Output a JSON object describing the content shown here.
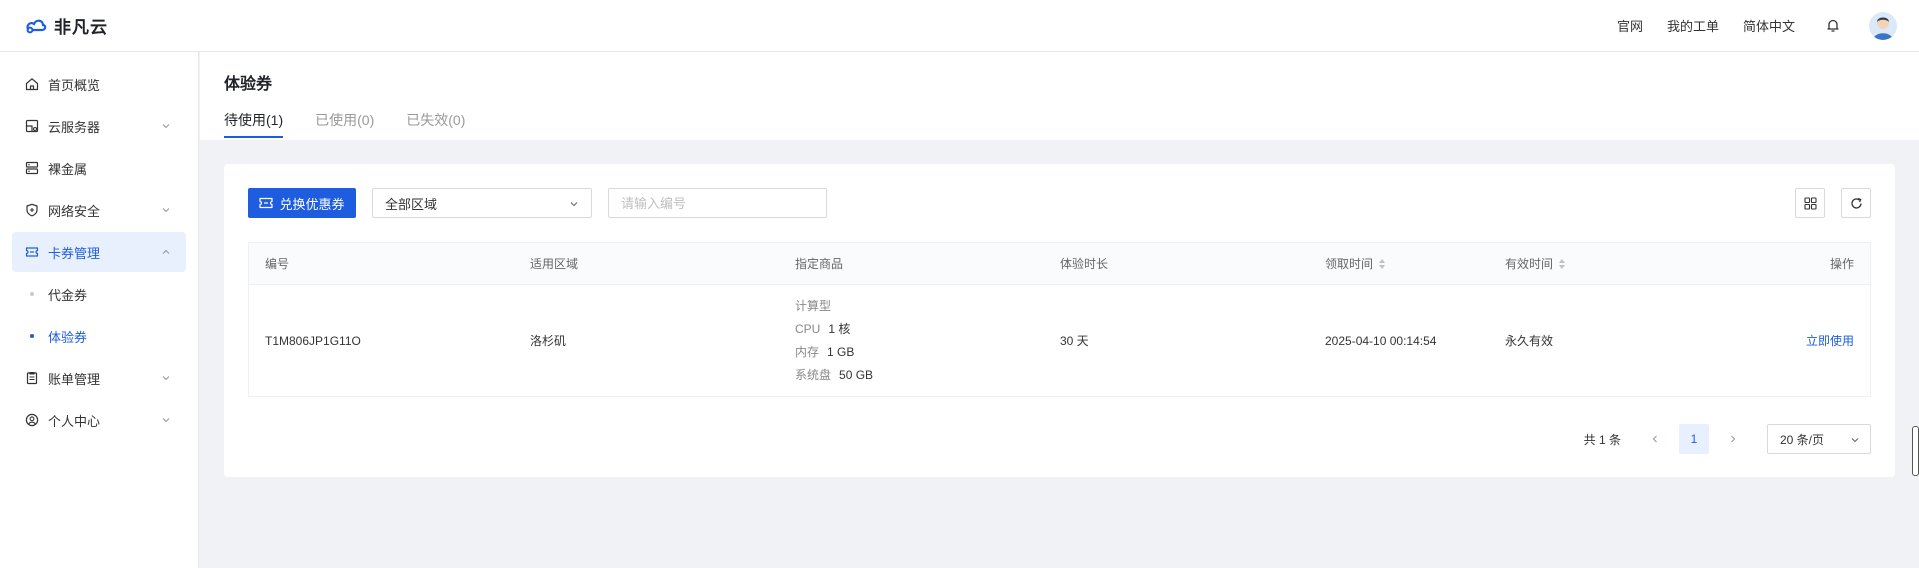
{
  "header": {
    "brand": "非凡云",
    "links": [
      "官网",
      "我的工单",
      "简体中文"
    ],
    "accent": "#1e5ddf"
  },
  "sidebar": {
    "items": [
      {
        "label": "首页概览",
        "icon": "home-icon"
      },
      {
        "label": "云服务器",
        "icon": "server-icon",
        "expandable": true
      },
      {
        "label": "裸金属",
        "icon": "bare-metal-icon"
      },
      {
        "label": "网络安全",
        "icon": "shield-icon",
        "expandable": true
      },
      {
        "label": "卡券管理",
        "icon": "ticket-icon",
        "expandable": true,
        "expanded": true,
        "active": true
      },
      {
        "label": "账单管理",
        "icon": "bill-icon",
        "expandable": true
      },
      {
        "label": "个人中心",
        "icon": "user-icon",
        "expandable": true
      }
    ],
    "sub_items": [
      {
        "label": "代金券",
        "active": false
      },
      {
        "label": "体验券",
        "active": true
      }
    ]
  },
  "page": {
    "title": "体验券",
    "tabs": [
      {
        "label": "待使用(1)",
        "active": true
      },
      {
        "label": "已使用(0)",
        "active": false
      },
      {
        "label": "已失效(0)",
        "active": false
      }
    ]
  },
  "toolbar": {
    "redeem_label": "兑换优惠券",
    "region_select": "全部区域",
    "search_placeholder": "请输入编号"
  },
  "table": {
    "columns": [
      "编号",
      "适用区域",
      "指定商品",
      "体验时长",
      "领取时间",
      "有效时间",
      "操作"
    ],
    "rows": [
      {
        "id": "T1M806JP1G11O",
        "region": "洛杉矶",
        "product_type": "计算型",
        "cpu_label": "CPU",
        "cpu": "1 核",
        "mem_label": "内存",
        "mem": "1 GB",
        "disk_label": "系统盘",
        "disk": "50 GB",
        "duration": "30 天",
        "received": "2025-04-10 00:14:54",
        "validity": "永久有效",
        "action": "立即使用"
      }
    ]
  },
  "pagination": {
    "total": "共 1 条",
    "current": "1",
    "page_size": "20 条/页"
  }
}
